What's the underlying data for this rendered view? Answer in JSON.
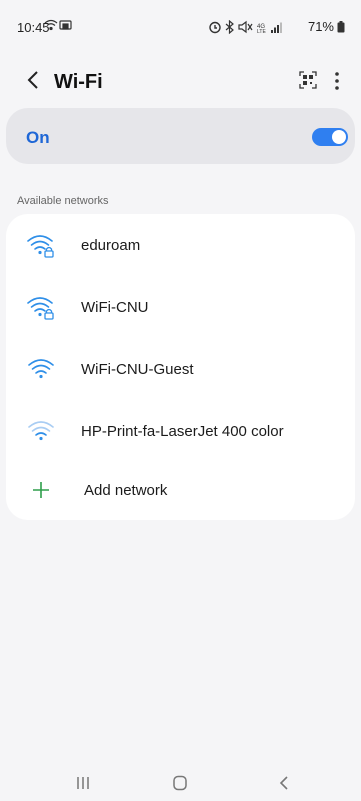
{
  "status_bar": {
    "time": "10:45",
    "battery": "71%",
    "icons": [
      "wifi-icon",
      "screen-cast-icon",
      "alarm-icon",
      "bluetooth-icon",
      "mute-icon",
      "lte-icon",
      "signal-icon",
      "battery-icon"
    ]
  },
  "header": {
    "title": "Wi-Fi",
    "back_icon": "chevron-left-icon",
    "qr_icon": "qr-scan-icon",
    "more_icon": "more-vertical-icon"
  },
  "wifi_toggle": {
    "label": "On",
    "enabled": true,
    "accent": "#2f7ff0"
  },
  "available_networks": {
    "heading": "Available networks",
    "items": [
      {
        "name": "eduroam",
        "secured": true,
        "strength": 4,
        "icon": "wifi-lock-icon"
      },
      {
        "name": "WiFi-CNU",
        "secured": true,
        "strength": 4,
        "icon": "wifi-lock-icon"
      },
      {
        "name": "WiFi-CNU-Guest",
        "secured": false,
        "strength": 4,
        "icon": "wifi-icon"
      },
      {
        "name": "HP-Print-fa-LaserJet 400 color",
        "secured": false,
        "strength": 2,
        "icon": "wifi-icon"
      }
    ],
    "add_label": "Add network",
    "add_icon": "plus-icon",
    "add_color": "#2e9e4b"
  },
  "nav_bar": {
    "icons": [
      "recent-apps-icon",
      "home-icon",
      "back-icon"
    ]
  }
}
